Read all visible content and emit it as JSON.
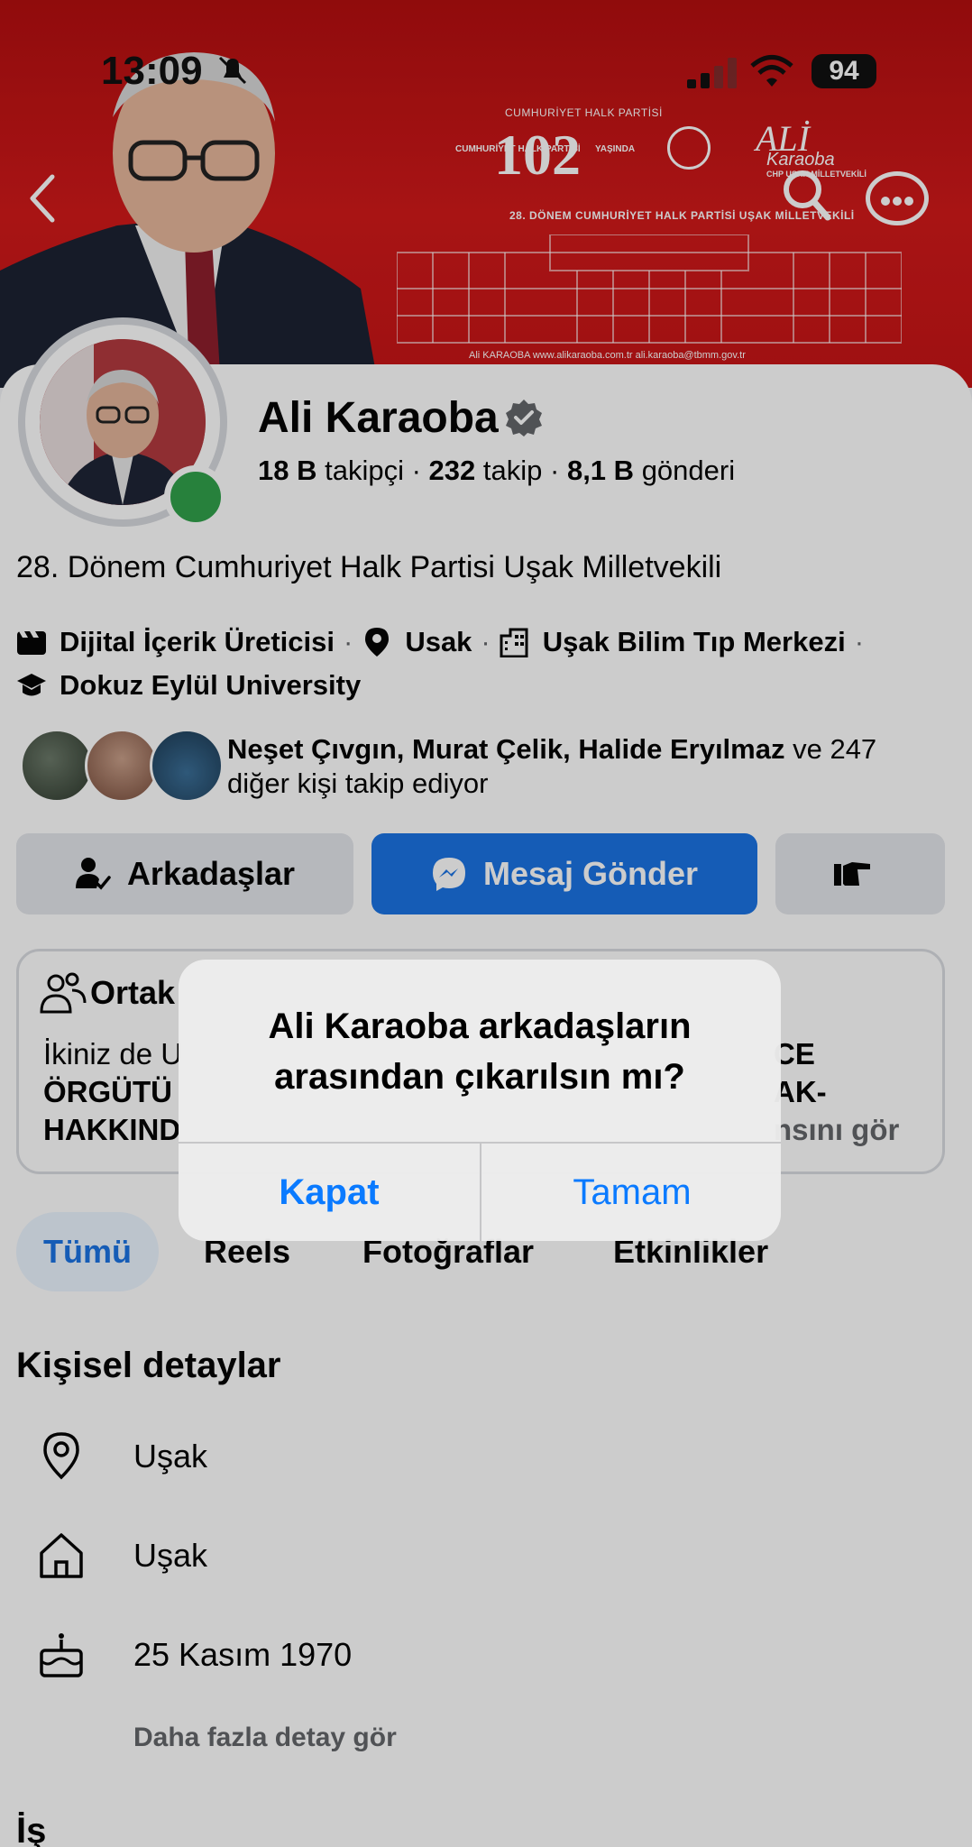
{
  "status_bar": {
    "time": "13:09",
    "battery": "94"
  },
  "cover": {
    "caption_top": "CUMHURİYET HALK PARTİSİ",
    "badge_number": "102",
    "badge_left": "CUMHURİYET HALK PARTİSİ",
    "badge_right": "YAŞINDA",
    "ali": "ALİ",
    "ali_sub": "Karaoba",
    "ali_role": "CHP UŞAK MİLLETVEKİLİ",
    "line": "28. DÖNEM  CUMHURİYET HALK PARTİSİ UŞAK MİLLETVEKİLİ",
    "footer": "Ali KARAOBA   www.alikaraoba.com.tr   ali.karaoba@tbmm.gov.tr"
  },
  "profile": {
    "name": "Ali Karaoba",
    "followers_count": "18 B",
    "followers_label": "takipçi",
    "following_count": "232",
    "following_label": "takip",
    "posts_count": "8,1 B",
    "posts_label": "gönderi",
    "bio": "28. Dönem Cumhuriyet Halk Partisi Uşak Milletvekili"
  },
  "meta": {
    "category": "Dijital İçerik Üreticisi",
    "location": "Usak",
    "workplace": "Uşak Bilim Tıp Merkezi",
    "education": "Dokuz Eylül University",
    "separator": "·"
  },
  "mutual": {
    "names": "Neşet Çıvgın, Murat Çelik, Halide Eryılmaz",
    "rest_line1": " ve 247",
    "rest_line2": "diğer kişi takip ediyor"
  },
  "actions": {
    "friends_label": "Arkadaşlar",
    "message_label": "Mesaj Gönder"
  },
  "common": {
    "title": "Ortak",
    "l1": "İkiniz de U",
    "l2": "ÖRGÜTÜ",
    "l3": "HAKKIND",
    "r1": "CE",
    "r2": "AK-",
    "r3": "nsını gör"
  },
  "tabs": [
    "Tümü",
    "Reels",
    "Fotoğraflar",
    "Etkinlikler"
  ],
  "personal": {
    "title": "Kişisel detaylar",
    "current_city": "Uşak",
    "hometown": "Uşak",
    "birthday": "25 Kasım 1970",
    "more": "Daha fazla detay gör"
  },
  "work": {
    "title": "İş"
  },
  "alert": {
    "title": "Ali Karaoba arkadaşların arasından çıkarılsın mı?",
    "cancel_label": "Kapat",
    "ok_label": "Tamam"
  },
  "colors": {
    "brand_blue": "#1b74e4",
    "ios_blue": "#0a7aff",
    "cover_red": "#d2191a",
    "online_green": "#31a24c"
  }
}
